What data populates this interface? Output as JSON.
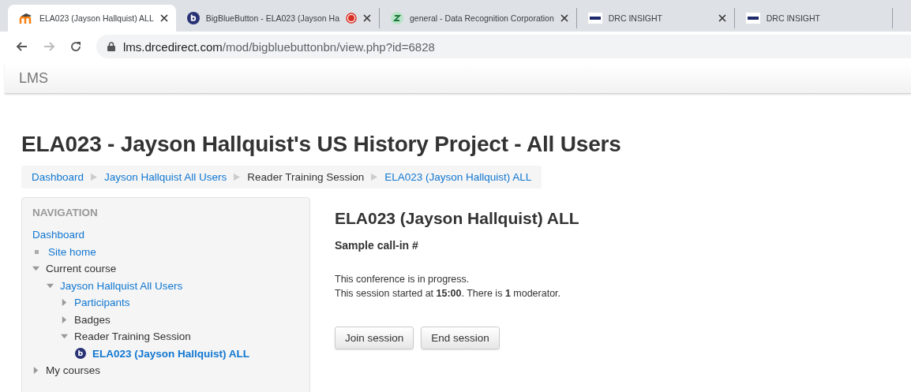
{
  "browser": {
    "tabs": [
      {
        "kind": "moodle",
        "title": "ELA023 (Jayson Hallquist) ALL",
        "selected": true,
        "closable": true,
        "recording": false
      },
      {
        "kind": "bbb",
        "title": "BigBlueButton - ELA023 (Jayson Ha",
        "selected": false,
        "closable": true,
        "recording": true
      },
      {
        "kind": "zulip",
        "title": "general - Data Recognition Corporation",
        "selected": false,
        "closable": true,
        "recording": false
      },
      {
        "kind": "drc",
        "title": "DRC INSIGHT",
        "selected": false,
        "closable": true,
        "recording": false
      },
      {
        "kind": "drc",
        "title": "DRC INSIGHT",
        "selected": false,
        "closable": false,
        "recording": false
      }
    ],
    "address": {
      "host": "lms.drcedirect.com",
      "path": "/mod/bigbluebuttonbn/view.php?id=6828"
    },
    "forward_disabled": true
  },
  "navbar": {
    "brand": "LMS"
  },
  "page_title": "ELA023 - Jayson Hallquist's US History Project - All Users",
  "breadcrumb": [
    {
      "label": "Dashboard",
      "link": true
    },
    {
      "label": "Jayson Hallquist All Users",
      "link": true
    },
    {
      "label": "Reader Training Session",
      "link": false
    },
    {
      "label": "ELA023 (Jayson Hallquist) ALL",
      "link": true
    }
  ],
  "navigation": {
    "title": "NAVIGATION",
    "items": [
      {
        "label": "Dashboard",
        "kind": "top",
        "link": true
      },
      {
        "label": "Site home",
        "kind": "page",
        "link": true
      },
      {
        "label": "Current course",
        "kind": "branch",
        "link": false,
        "expanded": true,
        "children": [
          {
            "label": "Jayson Hallquist All Users",
            "kind": "branch",
            "link": true,
            "expanded": true,
            "children": [
              {
                "label": "Participants",
                "kind": "branch",
                "link": true,
                "expanded": false
              },
              {
                "label": "Badges",
                "kind": "branch",
                "link": false,
                "expanded": false
              },
              {
                "label": "Reader Training Session",
                "kind": "branch",
                "link": false,
                "expanded": true,
                "children": [
                  {
                    "label": "ELA023 (Jayson Hallquist) ALL",
                    "kind": "activity",
                    "link": true
                  }
                ]
              }
            ]
          }
        ]
      },
      {
        "label": "My courses",
        "kind": "branch",
        "link": false,
        "expanded": false
      }
    ]
  },
  "main": {
    "heading": "ELA023 (Jayson Hallquist) ALL",
    "subheading": "Sample call-in #",
    "status_lines": [
      "This conference is in progress.",
      "This session started at **15:00**. There is **1** moderator."
    ],
    "buttons": [
      "Join session",
      "End session"
    ]
  }
}
